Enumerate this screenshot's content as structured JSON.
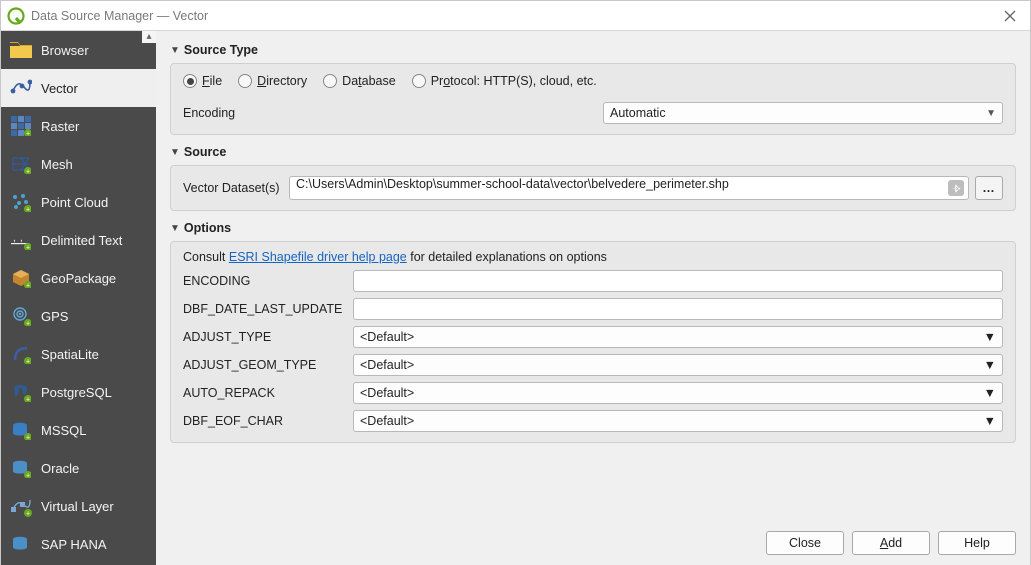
{
  "window": {
    "title": "Data Source Manager — Vector"
  },
  "sidebar": {
    "items": [
      {
        "label": "Browser"
      },
      {
        "label": "Vector"
      },
      {
        "label": "Raster"
      },
      {
        "label": "Mesh"
      },
      {
        "label": "Point Cloud"
      },
      {
        "label": "Delimited Text"
      },
      {
        "label": "GeoPackage"
      },
      {
        "label": "GPS"
      },
      {
        "label": "SpatiaLite"
      },
      {
        "label": "PostgreSQL"
      },
      {
        "label": "MSSQL"
      },
      {
        "label": "Oracle"
      },
      {
        "label": "Virtual Layer"
      },
      {
        "label": "SAP HANA"
      }
    ],
    "selected_index": 1
  },
  "source_type": {
    "title": "Source Type",
    "radios": {
      "file_prefix": "F",
      "file_rest": "ile",
      "directory_prefix": "D",
      "directory_rest": "irectory",
      "database_prefix": "Da",
      "database_rest": "tabase",
      "database_accel": "t",
      "protocol_prefix": "Pr",
      "protocol_rest": "otocol: HTTP(S), cloud, etc.",
      "protocol_accel": "o"
    },
    "file_label": "File",
    "directory_label": "Directory",
    "database_label": "Database",
    "protocol_label": "Protocol: HTTP(S), cloud, etc.",
    "encoding_label": "Encoding",
    "encoding_value": "Automatic"
  },
  "source": {
    "title": "Source",
    "dataset_label": "Vector Dataset(s)",
    "dataset_value": "C:\\Users\\Admin\\Desktop\\summer-school-data\\vector\\belvedere_perimeter.shp",
    "browse_label": "…"
  },
  "options": {
    "title": "Options",
    "consult_pre": "Consult ",
    "consult_link": "ESRI Shapefile driver help page",
    "consult_post": " for detailed explanations on options",
    "rows": [
      {
        "label": "ENCODING",
        "type": "text",
        "value": ""
      },
      {
        "label": "DBF_DATE_LAST_UPDATE",
        "type": "text",
        "value": ""
      },
      {
        "label": "ADJUST_TYPE",
        "type": "select",
        "value": "<Default>"
      },
      {
        "label": "ADJUST_GEOM_TYPE",
        "type": "select",
        "value": "<Default>"
      },
      {
        "label": "AUTO_REPACK",
        "type": "select",
        "value": "<Default>"
      },
      {
        "label": "DBF_EOF_CHAR",
        "type": "select",
        "value": "<Default>"
      }
    ]
  },
  "buttons": {
    "close": "Close",
    "add_prefix": "",
    "add_accel": "A",
    "add_rest": "dd",
    "help": "Help"
  }
}
